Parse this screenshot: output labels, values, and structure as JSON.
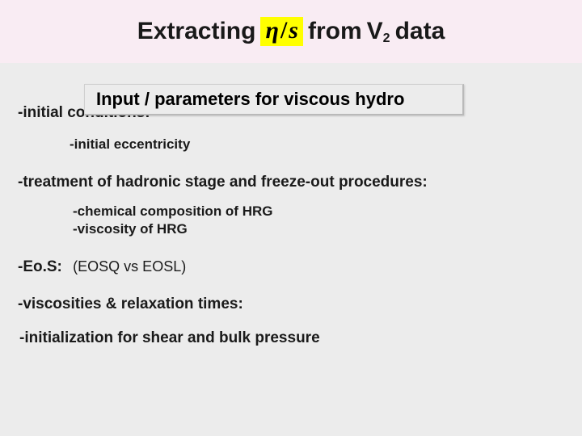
{
  "title": {
    "pre": "Extracting",
    "eta": "η",
    "slash": "/",
    "s": "s",
    "mid": " from ",
    "v": "V",
    "two": "2",
    "post": " data"
  },
  "subtitle": "Input / parameters for viscous hydro",
  "lines": {
    "initial_conditions": "-initial conditions:",
    "initial_eccentricity": "-initial eccentricity",
    "treatment": "-treatment of hadronic stage and freeze-out procedures:",
    "chem": "-chemical composition of HRG",
    "visc_hrg": "-viscosity of HRG",
    "eos_label": "-Eo.S:",
    "eos_detail": "(EOSQ vs EOSL)",
    "visc_relax": "-viscosities & relaxation times:",
    "init_shear": "-initialization for shear and bulk pressure"
  }
}
